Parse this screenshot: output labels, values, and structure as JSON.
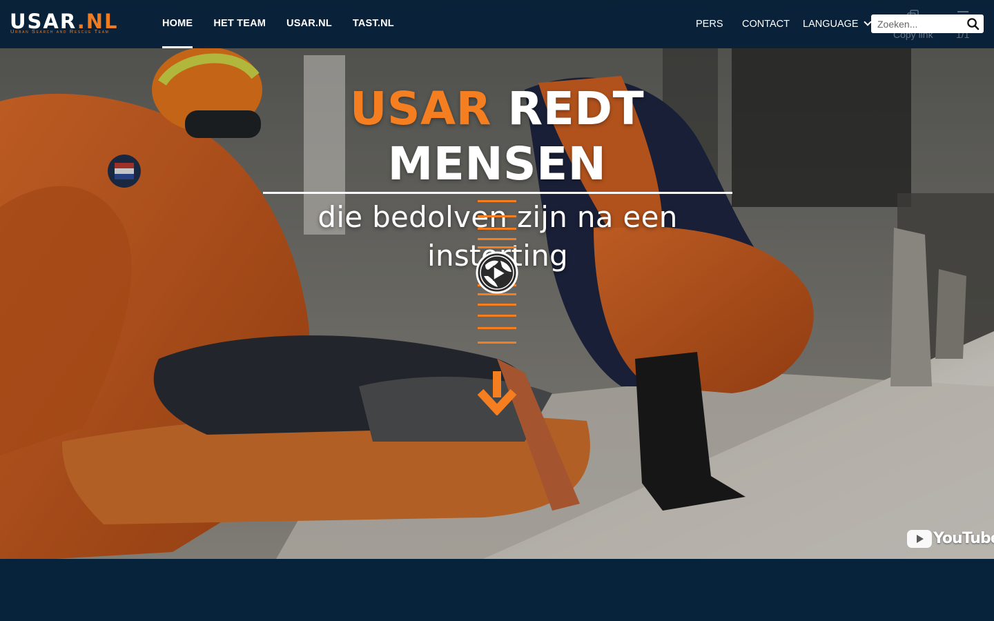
{
  "logo": {
    "brand_main": "USAR",
    "brand_dot": ".",
    "brand_tld": "NL",
    "tagline": "Urban Search and Rescue Team"
  },
  "nav": {
    "main": [
      {
        "label": "HOME",
        "active": true
      },
      {
        "label": "HET TEAM",
        "active": false
      },
      {
        "label": "USAR.NL",
        "active": false
      },
      {
        "label": "TAST.NL",
        "active": false
      }
    ],
    "pers": "PERS",
    "contact": "CONTACT",
    "language": "LANGUAGE"
  },
  "search": {
    "placeholder": "Zoeken..."
  },
  "video_overlay": {
    "copy_link": "Copy link",
    "counter": "1/1",
    "youtube": "YouTube"
  },
  "hero": {
    "title_accent": "USAR",
    "title_rest": "REDT MENSEN",
    "subtitle": "die bedolven zijn na een instorting"
  },
  "colors": {
    "accent": "#f47e20",
    "navy": "#07223b",
    "nav_bg": "#041e37"
  },
  "icons": [
    "search-icon",
    "chevron-down-icon",
    "copy-link-icon",
    "globe-play-icon",
    "arrow-down-icon",
    "youtube-play-icon"
  ]
}
